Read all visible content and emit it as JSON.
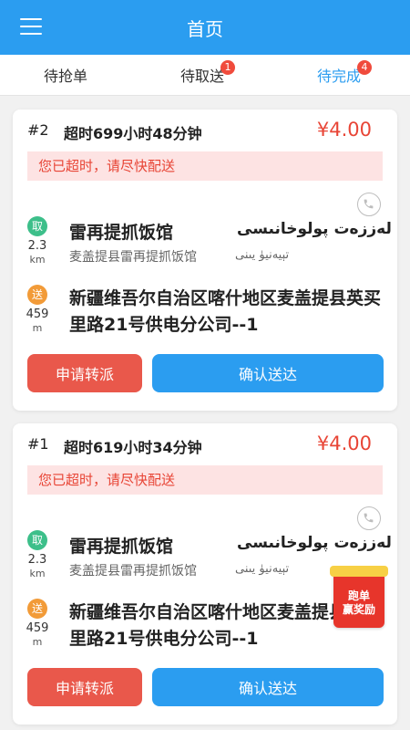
{
  "header": {
    "title": "首页",
    "menu_icon": "menu-icon"
  },
  "tabs": [
    {
      "label": "待抢单",
      "badge": ""
    },
    {
      "label": "待取送",
      "badge": "1"
    },
    {
      "label": "待完成",
      "badge": "4"
    }
  ],
  "orders": [
    {
      "number": "#2",
      "overtime": "超时699小时48分钟",
      "price": "¥4.00",
      "warning": "您已超时，请尽快配送",
      "pickup": {
        "badge": "取",
        "distance": "2.3",
        "unit": "km",
        "name": "雷再提抓饭馆",
        "name_ug": "لەززەت پولوخانىسى",
        "address": "麦盖提县雷再提抓饭馆",
        "address_ug": "تېيەنيۈ يىنى"
      },
      "delivery": {
        "badge": "送",
        "distance": "459",
        "unit": "m",
        "address": "新疆维吾尔自治区喀什地区麦盖提县英买里路21号供电分公司--1"
      },
      "transfer_label": "申请转派",
      "confirm_label": "确认送达"
    },
    {
      "number": "#1",
      "overtime": "超时619小时34分钟",
      "price": "¥4.00",
      "warning": "您已超时，请尽快配送",
      "pickup": {
        "badge": "取",
        "distance": "2.3",
        "unit": "km",
        "name": "雷再提抓饭馆",
        "name_ug": "لەززەت پولوخانىسى",
        "address": "麦盖提县雷再提抓饭馆",
        "address_ug": "تېيەنيۈ يىنى"
      },
      "delivery": {
        "badge": "送",
        "distance": "459",
        "unit": "m",
        "address": "新疆维吾尔自治区喀什地区麦盖提县英买里路21号供电分公司--1"
      },
      "transfer_label": "申请转派",
      "confirm_label": "确认送达"
    }
  ],
  "promo": {
    "line1": "跑单",
    "line2": "赢奖励"
  },
  "colors": {
    "primary": "#2b9df0",
    "danger": "#e84536",
    "pickup": "#3dbf8a",
    "delivery": "#f29b38"
  }
}
